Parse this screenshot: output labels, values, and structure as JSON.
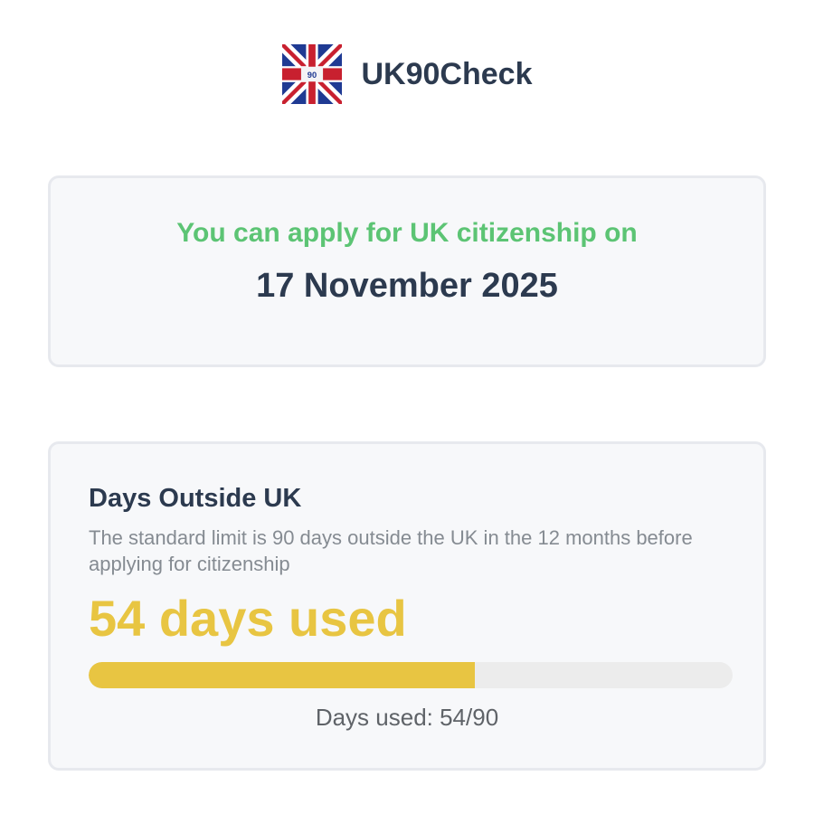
{
  "app": {
    "title": "UK90Check",
    "logo_icon": "union-jack-flag-icon",
    "logo_badge_text": "90"
  },
  "apply_card": {
    "label": "You can apply for UK citizenship on",
    "date": "17 November 2025",
    "label_color": "#5cc474"
  },
  "days_card": {
    "title": "Days Outside UK",
    "description": "The standard limit is 90 days outside the UK in the 12 months before applying for citizenship",
    "used_headline": "54 days used",
    "days_used": 54,
    "days_limit": 90,
    "progress_fraction": 0.6,
    "progress_color": "#e8c542",
    "caption": "Days used: 54/90"
  }
}
